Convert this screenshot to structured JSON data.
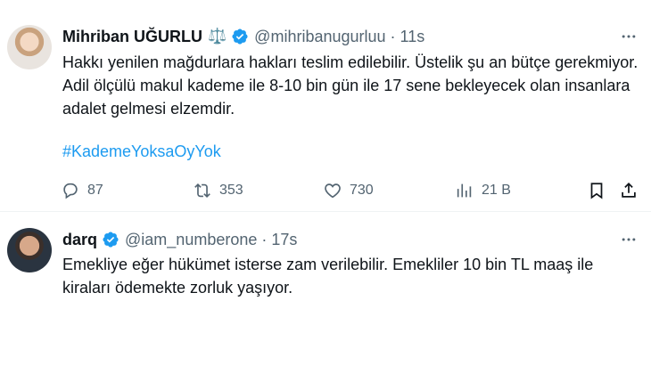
{
  "tweets": [
    {
      "name": "Mihriban UĞURLU",
      "emoji": "⚖️",
      "handle": "@mihribanugurluu",
      "time": "11s",
      "text": "Hakkı yenilen mağdurlara hakları teslim edilebilir. Üstelik şu an bütçe gerekmiyor. Adil ölçülü makul kademe ile 8-10 bin gün ile 17 sene bekleyecek olan insanlara adalet gelmesi elzemdir.",
      "hashtag": "#KademeYoksaOyYok",
      "replies": "87",
      "retweets": "353",
      "likes": "730",
      "views": "21 B"
    },
    {
      "name": "darq",
      "handle": "@iam_numberone",
      "time": "17s",
      "text": "Emekliye eğer hükümet isterse zam verilebilir. Emekliler 10 bin TL maaş ile kiraları ödemekte zorluk yaşıyor."
    }
  ],
  "icons": {
    "verified": "verified-badge-icon",
    "more": "more-icon",
    "reply": "reply-icon",
    "retweet": "retweet-icon",
    "like": "heart-icon",
    "views": "views-icon",
    "bookmark": "bookmark-icon",
    "share": "share-icon"
  },
  "colors": {
    "accent": "#1d9bf0",
    "muted": "#536471",
    "text": "#0f1419"
  }
}
